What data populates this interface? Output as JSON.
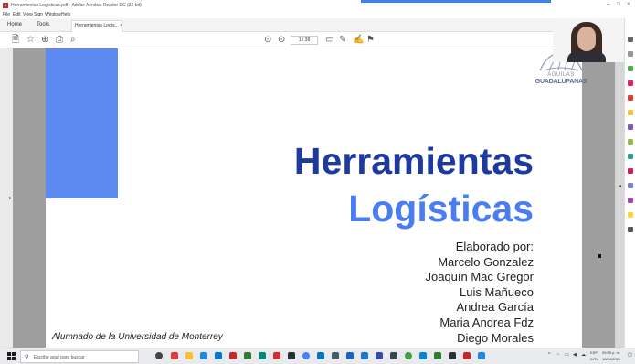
{
  "window": {
    "title": "Herramientas Logísticas.pdf - Adobe Acrobat Reader DC (32-bit)",
    "app_icon": "A",
    "menu": [
      "File",
      "Edit",
      "View",
      "Sign",
      "Window",
      "Help"
    ]
  },
  "tabs": {
    "home": "Home",
    "tools": "Tools",
    "doc": "Herramientas Logís... ×"
  },
  "toolbar": {
    "page_current": "1",
    "page_total": "/ 38",
    "icons": [
      "save-icon",
      "star-icon",
      "upload-icon",
      "print-icon",
      "zoom-icon",
      "up-icon",
      "down-icon",
      "comment-icon",
      "pen-icon",
      "sign-icon",
      "tag-icon"
    ]
  },
  "slide": {
    "title_line1": "Herramientas",
    "title_line2": "Logísticas",
    "byline": "Elaborado por:",
    "authors": [
      "Marcelo Gonzalez",
      "Joaquín Mac Gregor",
      "Luis Mañueco",
      "Andrea García",
      "Maria Andrea Fdz",
      "Diego Morales"
    ],
    "footer": "Alumnado de la Universidad de Monterrey",
    "logo_line1": "ÁGUILAS",
    "logo_line2": "GUADALUPANAS"
  },
  "taskbar": {
    "search_placeholder": "Escribe aquí para buscar",
    "tray_lang": "ESP",
    "tray_region": "INTL",
    "time": "09:55 p. m.",
    "date": "10/04/2021"
  },
  "colors": {
    "title_dark": "#1e3a9e",
    "title_light": "#4a7ef0",
    "block_blue": "#5d8af0"
  }
}
